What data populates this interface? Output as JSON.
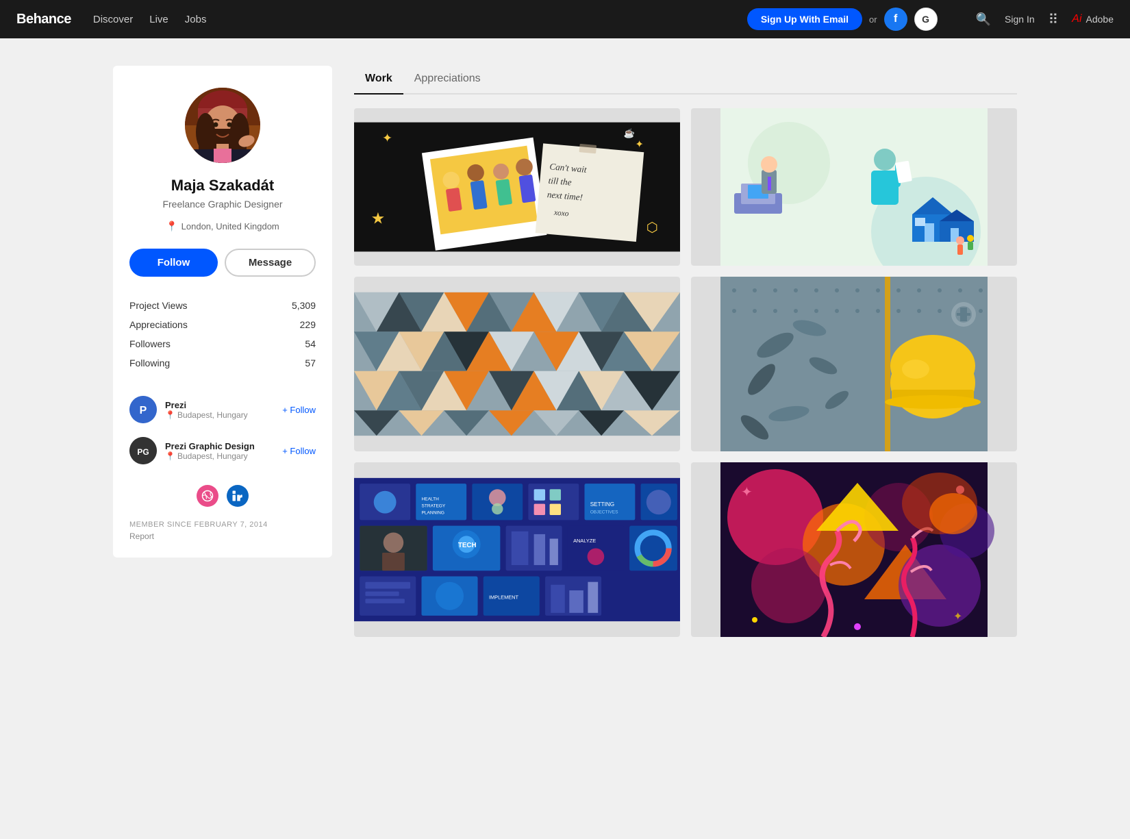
{
  "navbar": {
    "logo": "Behance",
    "links": [
      {
        "label": "Discover",
        "active": false
      },
      {
        "label": "Live",
        "active": false
      },
      {
        "label": "Jobs",
        "active": false
      }
    ],
    "signup_label": "Sign Up With Email",
    "or_label": "or",
    "facebook_label": "f",
    "google_label": "G",
    "signin_label": "Sign In",
    "adobe_label": "Adobe"
  },
  "profile": {
    "name": "Maja Szakadát",
    "title": "Freelance Graphic Designer",
    "location": "London, United Kingdom",
    "follow_label": "Follow",
    "message_label": "Message",
    "stats": [
      {
        "label": "Project Views",
        "value": "5,309"
      },
      {
        "label": "Appreciations",
        "value": "229"
      },
      {
        "label": "Followers",
        "value": "54"
      },
      {
        "label": "Following",
        "value": "57"
      }
    ],
    "following_companies": [
      {
        "name": "Prezi",
        "location": "Budapest, Hungary",
        "initials": "P"
      },
      {
        "name": "Prezi Graphic Design",
        "location": "Budapest, Hungary",
        "initials": "PG"
      }
    ],
    "follow_plus_label": "+ Follow",
    "member_since": "MEMBER SINCE FEBRUARY 7, 2014",
    "report_label": "Report"
  },
  "tabs": [
    {
      "label": "Work",
      "active": true
    },
    {
      "label": "Appreciations",
      "active": false
    }
  ],
  "projects": [
    {
      "id": 1,
      "type": "polaroid"
    },
    {
      "id": 2,
      "type": "illustration"
    },
    {
      "id": 3,
      "type": "triangles"
    },
    {
      "id": 4,
      "type": "helmet"
    },
    {
      "id": 5,
      "type": "presentation"
    },
    {
      "id": 6,
      "type": "colorful"
    }
  ]
}
